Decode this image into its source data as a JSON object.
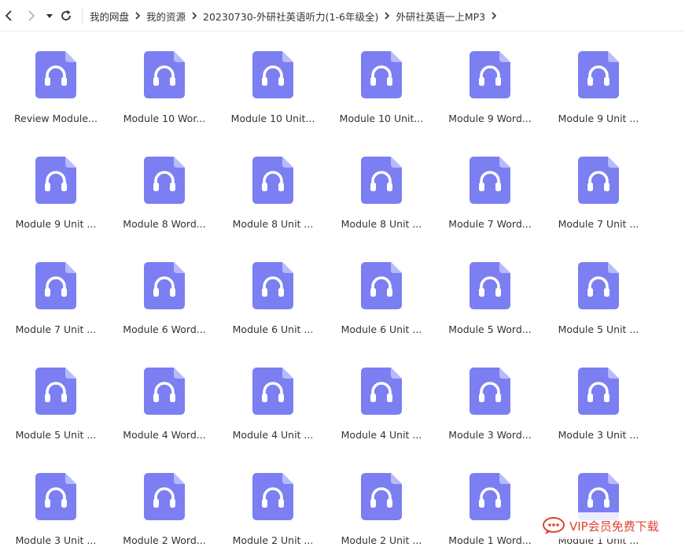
{
  "nav": {
    "back_icon": "chevron-left-icon",
    "forward_icon": "chevron-right-icon",
    "dropdown_icon": "caret-down-icon",
    "refresh_icon": "refresh-icon"
  },
  "breadcrumb": [
    "我的网盘",
    "我的资源",
    "20230730-外研社英语听力(1-6年级全)",
    "外研社英语一上MP3"
  ],
  "file_icon": "audio-file-icon",
  "files": [
    "Review Module...",
    "Module 10 Wor...",
    "Module 10 Unit...",
    "Module 10 Unit...",
    "Module 9 Word...",
    "Module 9 Unit ...",
    "Module 9 Unit ...",
    "Module 8 Word...",
    "Module 8 Unit ...",
    "Module 8 Unit ...",
    "Module 7 Word...",
    "Module 7 Unit ...",
    "Module 7 Unit ...",
    "Module 6 Word...",
    "Module 6 Unit ...",
    "Module 6 Unit ...",
    "Module 5 Word...",
    "Module 5 Unit ...",
    "Module 5 Unit ...",
    "Module 4 Word...",
    "Module 4 Unit ...",
    "Module 4 Unit ...",
    "Module 3 Word...",
    "Module 3 Unit ...",
    "Module 3 Unit ...",
    "Module 2 Word...",
    "Module 2 Unit ...",
    "Module 2 Unit ...",
    "Module 1 Word...",
    "Module 1 Unit ..."
  ],
  "watermark": {
    "text": "VIP会员免费下载",
    "icon": "chat-bubble-icon"
  },
  "colors": {
    "icon_bg": "#7b7ff2",
    "icon_fold": "#b7bafc",
    "watermark": "#e0432f"
  }
}
